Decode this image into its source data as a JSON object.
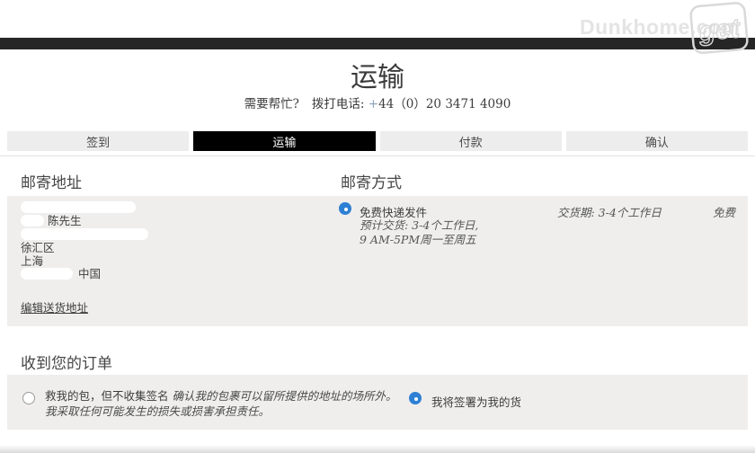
{
  "watermark": {
    "text": "Dunkhome.com",
    "logo_text": "get"
  },
  "header": {
    "title": "运输",
    "help_prefix": "需要帮忙?",
    "call_label": "拨打电话:",
    "phone_plus": "+",
    "phone_number": "44（0）20 3471 4090"
  },
  "tabs": [
    {
      "label": "签到",
      "active": false
    },
    {
      "label": "运输",
      "active": true
    },
    {
      "label": "付款",
      "active": false
    },
    {
      "label": "确认",
      "active": false
    }
  ],
  "shipping_address": {
    "heading": "邮寄地址",
    "name_visible": "陈先生",
    "district": "徐汇区",
    "city": "上海",
    "country": "中国",
    "edit_link": "编辑送货地址"
  },
  "shipping_method": {
    "heading": "邮寄方式",
    "option_name": "免费快递发件",
    "detail_line1": "预计交货: 3-4个工作日,",
    "detail_line2": "9 AM-5PM周一至周五",
    "delivery_label": "交货期: 3-4个工作日",
    "price": "免费",
    "selected": true
  },
  "receive_order": {
    "heading": "收到您的订单",
    "option_a": {
      "text_normal": "救我的包，但不收集签名 ",
      "text_italic": "确认我的包裹可以留所提供的地址的场所外。我采取任何可能发生的损失或损害承担责任。",
      "selected": false
    },
    "option_b": {
      "text": "我将签署为我的货",
      "selected": true
    }
  },
  "colors": {
    "accent_blue": "#2e80d4",
    "top_bar": "#262626",
    "tab_active_bg": "#000000",
    "tab_inactive_bg": "#ededed",
    "panel_bg": "#efeeed"
  }
}
